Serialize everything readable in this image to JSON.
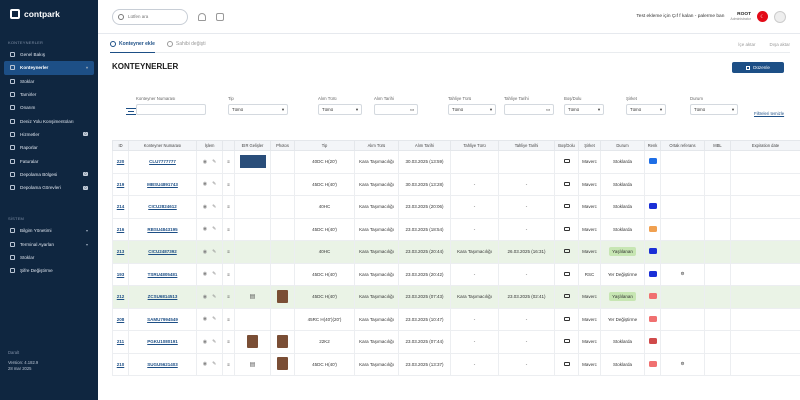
{
  "sidebar": {
    "logo_text": "contpark",
    "section_main": "KONTEYNERLER",
    "items": [
      {
        "label": "Genel Bakış",
        "badge": "",
        "chevron": false
      },
      {
        "label": "Konteynerler",
        "badge": "",
        "chevron": true,
        "active": true
      },
      {
        "label": "Stoklar",
        "badge": "",
        "chevron": false
      },
      {
        "label": "Tamirler",
        "badge": "",
        "chevron": false
      },
      {
        "label": "Onarım",
        "badge": "",
        "chevron": false
      },
      {
        "label": "Deniz Yolu Konşimentoları",
        "badge": "",
        "chevron": false
      },
      {
        "label": "Hizmetler",
        "badge": "0",
        "chevron": false
      },
      {
        "label": "Raporlar",
        "badge": "",
        "chevron": false
      },
      {
        "label": "Faturalar",
        "badge": "",
        "chevron": false
      },
      {
        "label": "Depolama Bölgesi",
        "badge": "0",
        "chevron": false
      },
      {
        "label": "Depolama Görevleri",
        "badge": "0",
        "chevron": false
      }
    ],
    "section_system": "SİSTEM",
    "sys_items": [
      {
        "label": "Bilgim Yönetimi",
        "chevron": true
      },
      {
        "label": "Terminal Ayarları",
        "chevron": true
      },
      {
        "label": "Stoklar",
        "chevron": false
      },
      {
        "label": "Şifre Değiştirme",
        "chevron": false
      }
    ],
    "collapse_label": "Daralt",
    "version": "Version: 4.182.9",
    "date": "28 mar 2025"
  },
  "topbar": {
    "search_placeholder": "Lütfen ara",
    "marquee": "Test ekleme için Çıf f kalan - palerme ban",
    "user_name": "ROOT",
    "user_role": "Administrator",
    "flag_symbol": "☾"
  },
  "tabs": [
    {
      "label": "Konteyner ekle",
      "active": true
    },
    {
      "label": "Sahibi değişti",
      "active": false
    }
  ],
  "tab_actions": [
    "İçe aktar",
    "Dışa aktar"
  ],
  "page": {
    "title": "KONTEYNERLER",
    "button": "Düzenle"
  },
  "filters": [
    {
      "label": "Konteyner Numarası",
      "value": ""
    },
    {
      "label": "Tip",
      "value": "Tümü"
    },
    {
      "label": "Alım Türü",
      "value": "Tümü"
    },
    {
      "label": "Alım Tarihi",
      "value": ""
    },
    {
      "label": "Tahliye Türü",
      "value": "Tümü"
    },
    {
      "label": "Tahliye Tarihi",
      "value": ""
    },
    {
      "label": "Boş/Dolu",
      "value": "Tümü"
    },
    {
      "label": "Şirket",
      "value": "Tümü"
    },
    {
      "label": "Durum",
      "value": "Tümü"
    }
  ],
  "clear_filters": "Filtreleri temizle",
  "table": {
    "headers": [
      "ID",
      "Konteyner Numarası",
      "İşlem",
      "",
      "EIR Gelişler",
      "Photos",
      "Tip",
      "Alım Türü",
      "Alım Tarihi",
      "Tahliye Türü",
      "Tahliye Tarihi",
      "Boş/Dolu",
      "Şirket",
      "Durum",
      "Renk",
      "Ortak referans",
      "MBL",
      "Expiration date"
    ],
    "rows": [
      {
        "id": "220",
        "no": "CLU7777777",
        "eir": "blue",
        "photo": "",
        "tip": "40DC H(20')",
        "alim_turu": "Kara Taşımacılığı",
        "alim_tarihi": "30.03.2025 (13:59)",
        "tahliye_turu": "",
        "tahliye_tarihi": "",
        "company": "Maverc",
        "status": "Stoklarda",
        "color": "#1e6ee6",
        "ortak": "",
        "hl": false
      },
      {
        "id": "219",
        "no": "MBSU4891743",
        "eir": "",
        "photo": "",
        "tip": "45DC H(40')",
        "alim_turu": "Kara Taşımacılığı",
        "alim_tarihi": "30.03.2025 (13:28)",
        "tahliye_turu": "-",
        "tahliye_tarihi": "-",
        "company": "Maverc",
        "status": "Stoklarda",
        "color": "",
        "ortak": "",
        "hl": false
      },
      {
        "id": "214",
        "no": "CICU2824612",
        "eir": "",
        "photo": "",
        "tip": "40HC",
        "alim_turu": "Kara Taşımacılığı",
        "alim_tarihi": "23.03.2025 (20:06)",
        "tahliye_turu": "-",
        "tahliye_tarihi": "-",
        "company": "Maverc",
        "status": "Stoklarda",
        "color": "#1a2fd6",
        "ortak": "",
        "hl": false
      },
      {
        "id": "216",
        "no": "RBSU4843195",
        "eir": "",
        "photo": "",
        "tip": "45DC H(40')",
        "alim_turu": "Kara Taşımacılığı",
        "alim_tarihi": "23.03.2025 (18:54)",
        "tahliye_turu": "-",
        "tahliye_tarihi": "-",
        "company": "Maverc",
        "status": "Stoklarda",
        "color": "#f0a050",
        "ortak": "",
        "hl": false
      },
      {
        "id": "213",
        "no": "CICU2487392",
        "eir": "",
        "photo": "",
        "tip": "40HC",
        "alim_turu": "Kara Taşımacılığı",
        "alim_tarihi": "23.03.2025 (20:44)",
        "tahliye_turu": "Kara Taşımacılığı",
        "tahliye_tarihi": "26.03.2025 (16:31)",
        "company": "Maverc",
        "status": "Yaşlılanan",
        "color": "#1a2fd6",
        "ortak": "",
        "hl": true
      },
      {
        "id": "193",
        "no": "TSRU4805481",
        "eir": "",
        "photo": "",
        "tip": "45DC H(40')",
        "alim_turu": "Kara Taşımacılığı",
        "alim_tarihi": "23.03.2025 (20:42)",
        "tahliye_turu": "-",
        "tahliye_tarihi": "-",
        "company": "RSC",
        "status": "Yer Değiştirme",
        "color": "#1a2fd6",
        "ortak": "⚙",
        "hl": false
      },
      {
        "id": "212",
        "no": "ZCSU6814513",
        "eir": "doc",
        "photo": "brown",
        "tip": "45DC H(40')",
        "alim_turu": "Kara Taşımacılığı",
        "alim_tarihi": "23.03.2025 (07:43)",
        "tahliye_turu": "Kara Taşımacılığı",
        "tahliye_tarihi": "23.03.2025 (02:41)",
        "company": "Maverc",
        "status": "Yaşlılanan",
        "color": "#f07070",
        "ortak": "",
        "hl": true
      },
      {
        "id": "208",
        "no": "SAMU7994549",
        "eir": "",
        "photo": "",
        "tip": "45RC H(40')(20')",
        "alim_turu": "Kara Taşımacılığı",
        "alim_tarihi": "23.03.2025 (10:47)",
        "tahliye_turu": "-",
        "tahliye_tarihi": "-",
        "company": "Maverc",
        "status": "Yer Değiştirme",
        "color": "#f07070",
        "ortak": "",
        "hl": false
      },
      {
        "id": "211",
        "no": "PGKU1080191",
        "eir": "brown",
        "photo": "brown",
        "tip": "22K2",
        "alim_turu": "Kara Taşımacılığı",
        "alim_tarihi": "23.03.2025 (07:44)",
        "tahliye_turu": "-",
        "tahliye_tarihi": "-",
        "company": "Maverc",
        "status": "Stoklarda",
        "color": "#d04a4a",
        "ortak": "",
        "hl": false
      },
      {
        "id": "210",
        "no": "SUGU5621403",
        "eir": "doc",
        "photo": "brown",
        "tip": "45DC H(40')",
        "alim_turu": "Kara Taşımacılığı",
        "alim_tarihi": "23.03.2025 (13:37)",
        "tahliye_turu": "-",
        "tahliye_tarihi": "-",
        "company": "Maverc",
        "status": "Stoklarda",
        "color": "#f07070",
        "ortak": "⚙",
        "hl": false
      }
    ]
  }
}
